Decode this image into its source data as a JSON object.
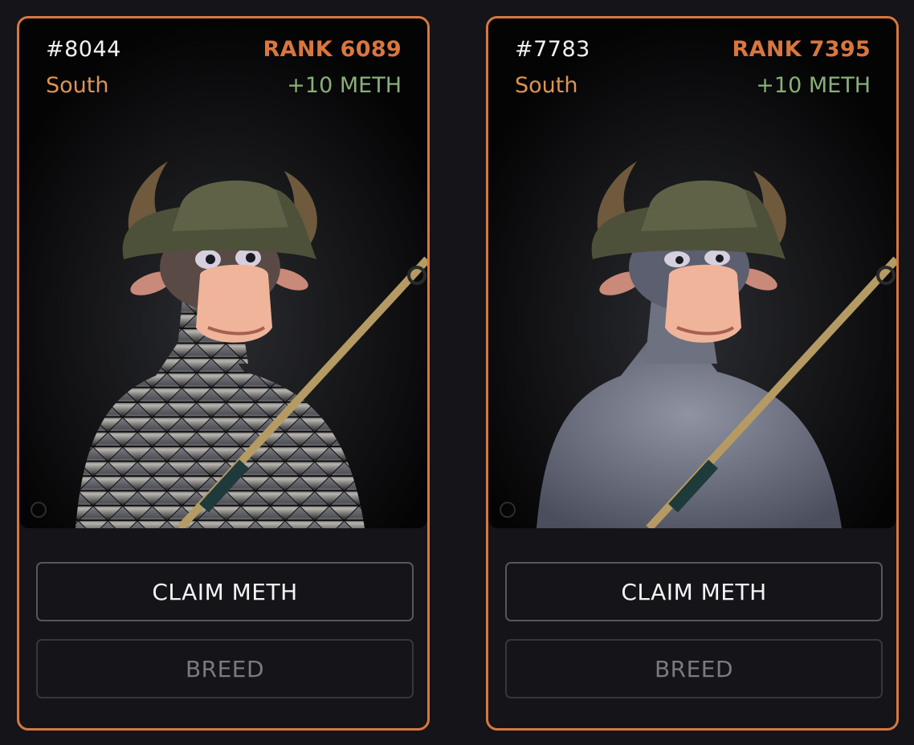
{
  "cards": [
    {
      "token_id": "#8044",
      "region": "South",
      "rank": "RANK 6089",
      "reward": "+10 METH",
      "claim_label": "CLAIM METH",
      "breed_label": "BREED",
      "character": {
        "body_style": "mirror-mosaic",
        "icon": "bull-character-image"
      }
    },
    {
      "token_id": "#7783",
      "region": "South",
      "rank": "RANK 7395",
      "reward": "+10 METH",
      "claim_label": "CLAIM METH",
      "breed_label": "BREED",
      "character": {
        "body_style": "grey-fur",
        "icon": "bull-character-image"
      }
    }
  ],
  "colors": {
    "accent": "#d9773f",
    "region_text": "#dc9555",
    "reward_text": "#8ab078",
    "background": "#141419"
  }
}
